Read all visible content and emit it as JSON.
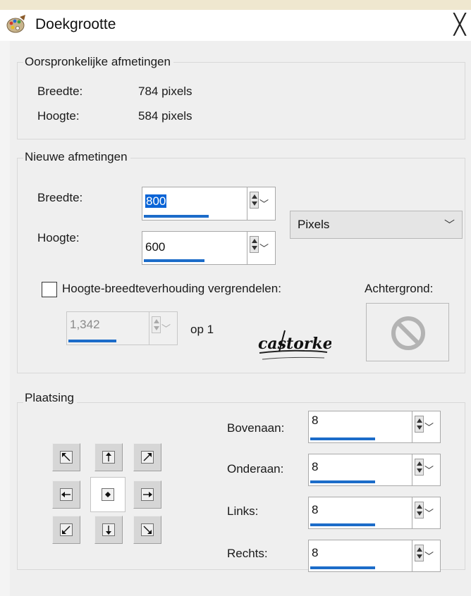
{
  "window": {
    "title": "Doekgrootte",
    "close_glyph": "╳"
  },
  "original": {
    "legend": "Oorspronkelijke afmetingen",
    "width_label": "Breedte:",
    "width_value": "784 pixels",
    "height_label": "Hoogte:",
    "height_value": "584 pixels"
  },
  "new_size": {
    "legend": "Nieuwe afmetingen",
    "width_label": "Breedte:",
    "width_value": "800",
    "height_label": "Hoogte:",
    "height_value": "600",
    "unit_selected": "Pixels",
    "lock_label": "Hoogte-breedteverhouding vergrendelen:",
    "lock_checked": false,
    "ratio_value": "1,342",
    "ratio_suffix": "op 1",
    "background_label": "Achtergrond:"
  },
  "placement": {
    "legend": "Plaatsing",
    "top_label": "Bovenaan:",
    "top_value": "8",
    "bottom_label": "Onderaan:",
    "bottom_value": "8",
    "left_label": "Links:",
    "left_value": "8",
    "right_label": "Rechts:",
    "right_value": "8",
    "selected_anchor": "center"
  },
  "logo": {
    "text": "castorke"
  },
  "colors": {
    "accent": "#1c6cc9",
    "selection": "#0a64d6"
  }
}
